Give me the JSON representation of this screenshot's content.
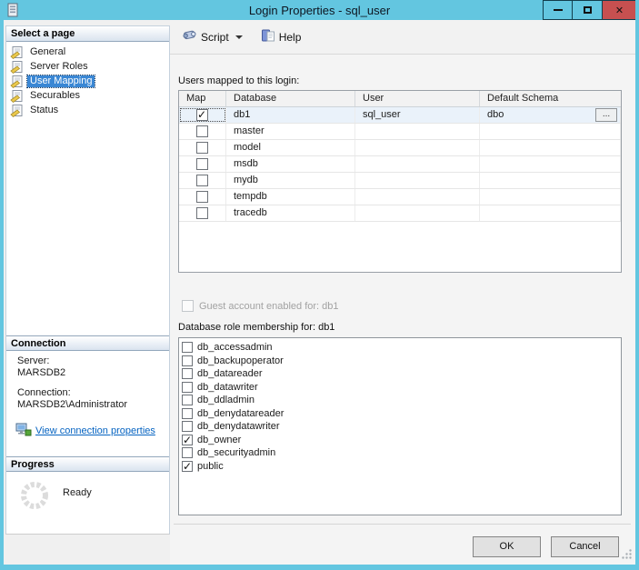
{
  "window": {
    "title": "Login Properties - sql_user"
  },
  "colors": {
    "titlebar": "#63c6e0",
    "close_red": "#c75050",
    "selection": "#3a87d4",
    "link": "#0563c1"
  },
  "sidebar": {
    "select_page": {
      "header": "Select a page",
      "items": [
        {
          "label": "General",
          "selected": false
        },
        {
          "label": "Server Roles",
          "selected": false
        },
        {
          "label": "User Mapping",
          "selected": true
        },
        {
          "label": "Securables",
          "selected": false
        },
        {
          "label": "Status",
          "selected": false
        }
      ]
    },
    "connection": {
      "header": "Connection",
      "server_label": "Server:",
      "server_value": "MARSDB2",
      "connection_label": "Connection:",
      "connection_value": "MARSDB2\\Administrator",
      "link_label": "View connection properties"
    },
    "progress": {
      "header": "Progress",
      "status": "Ready"
    }
  },
  "toolbar": {
    "script_label": "Script",
    "help_label": "Help"
  },
  "main": {
    "users_mapped_label": "Users mapped to this login:",
    "table": {
      "browse_label": "...",
      "columns": [
        "Map",
        "Database",
        "User",
        "Default Schema"
      ],
      "rows": [
        {
          "map": true,
          "database": "db1",
          "user": "sql_user",
          "default_schema": "dbo",
          "selected": true
        },
        {
          "map": false,
          "database": "master",
          "user": "",
          "default_schema": "",
          "selected": false
        },
        {
          "map": false,
          "database": "model",
          "user": "",
          "default_schema": "",
          "selected": false
        },
        {
          "map": false,
          "database": "msdb",
          "user": "",
          "default_schema": "",
          "selected": false
        },
        {
          "map": false,
          "database": "mydb",
          "user": "",
          "default_schema": "",
          "selected": false
        },
        {
          "map": false,
          "database": "tempdb",
          "user": "",
          "default_schema": "",
          "selected": false
        },
        {
          "map": false,
          "database": "tracedb",
          "user": "",
          "default_schema": "",
          "selected": false
        }
      ]
    },
    "guest_checkbox": {
      "label": "Guest account enabled for: db1",
      "checked": false,
      "enabled": false
    },
    "role_membership_label": "Database role membership for: db1",
    "roles": [
      {
        "name": "db_accessadmin",
        "checked": false
      },
      {
        "name": "db_backupoperator",
        "checked": false
      },
      {
        "name": "db_datareader",
        "checked": false
      },
      {
        "name": "db_datawriter",
        "checked": false
      },
      {
        "name": "db_ddladmin",
        "checked": false
      },
      {
        "name": "db_denydatareader",
        "checked": false
      },
      {
        "name": "db_denydatawriter",
        "checked": false
      },
      {
        "name": "db_owner",
        "checked": true
      },
      {
        "name": "db_securityadmin",
        "checked": false
      },
      {
        "name": "public",
        "checked": true
      }
    ]
  },
  "footer": {
    "ok_label": "OK",
    "cancel_label": "Cancel"
  }
}
